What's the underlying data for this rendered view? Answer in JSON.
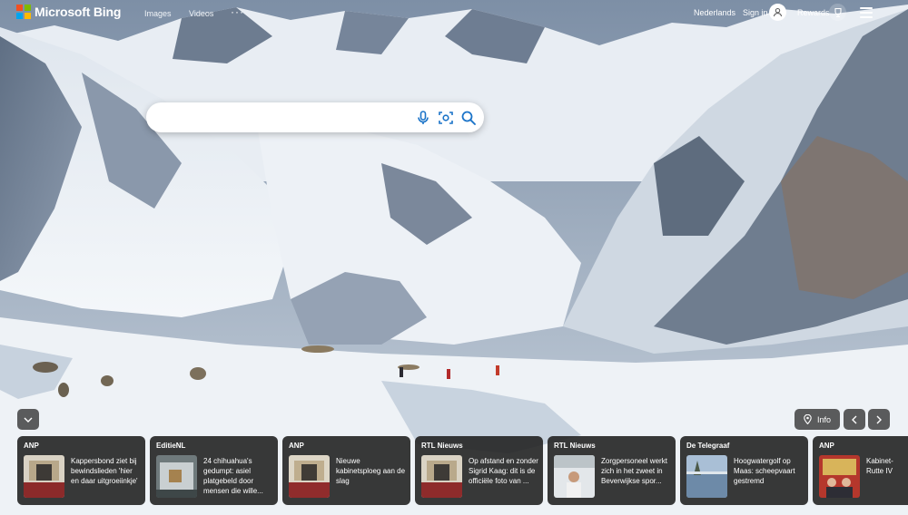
{
  "header": {
    "brand": "Microsoft Bing",
    "nav": [
      "Images",
      "Videos"
    ],
    "more": "···",
    "language": "Nederlands",
    "sign_in": "Sign in",
    "rewards": "Rewards"
  },
  "search": {
    "placeholder": "",
    "value": ""
  },
  "controls": {
    "info_label": "Info"
  },
  "news": [
    {
      "source": "ANP",
      "headline": "Kappersbond ziet bij bewindslieden 'hier en daar uitgroeiinkje'"
    },
    {
      "source": "EditieNL",
      "headline": "24 chihuahua's gedumpt: asiel platgebeld door mensen die wille..."
    },
    {
      "source": "ANP",
      "headline": "Nieuwe kabinetsploeg aan de slag"
    },
    {
      "source": "RTL Nieuws",
      "headline": "Op afstand en zonder Sigrid Kaag: dit is de officiële foto van ..."
    },
    {
      "source": "RTL Nieuws",
      "headline": "Zorgpersoneel werkt zich in het zweet in Beverwijkse spor..."
    },
    {
      "source": "De Telegraaf",
      "headline": "Hoogwatergolf op Maas: scheepvaart gestremd"
    },
    {
      "source": "ANP",
      "headline": "Kabinet-Rutte IV beëdigd"
    }
  ],
  "colors": {
    "logo": [
      "#f25022",
      "#7fba00",
      "#00a4ef",
      "#ffb900"
    ],
    "search_icon": "#1a73c8"
  }
}
